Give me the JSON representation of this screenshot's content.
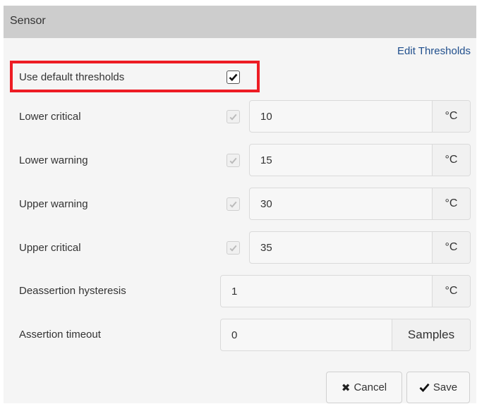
{
  "dialog": {
    "title": "Sensor",
    "edit_thresholds_label": "Edit Thresholds"
  },
  "default_thresholds": {
    "label": "Use default thresholds",
    "checked": true
  },
  "thresholds": [
    {
      "label": "Lower critical",
      "value": "10",
      "unit": "°C",
      "enabled": true
    },
    {
      "label": "Lower warning",
      "value": "15",
      "unit": "°C",
      "enabled": true
    },
    {
      "label": "Upper warning",
      "value": "30",
      "unit": "°C",
      "enabled": true
    },
    {
      "label": "Upper critical",
      "value": "35",
      "unit": "°C",
      "enabled": true
    }
  ],
  "hysteresis": {
    "label": "Deassertion hysteresis",
    "value": "1",
    "unit": "°C"
  },
  "timeout": {
    "label": "Assertion timeout",
    "value": "0",
    "unit": "Samples"
  },
  "buttons": {
    "cancel_label": "Cancel",
    "save_label": "Save"
  },
  "colors": {
    "header_bg": "#cdcdcd",
    "link": "#1f4e8c",
    "highlight": "#ed1c24",
    "panel_bg": "#f5f5f5"
  },
  "icons": {
    "checkbox_checked": "check-icon",
    "cancel": "x-icon",
    "save": "check-icon"
  }
}
